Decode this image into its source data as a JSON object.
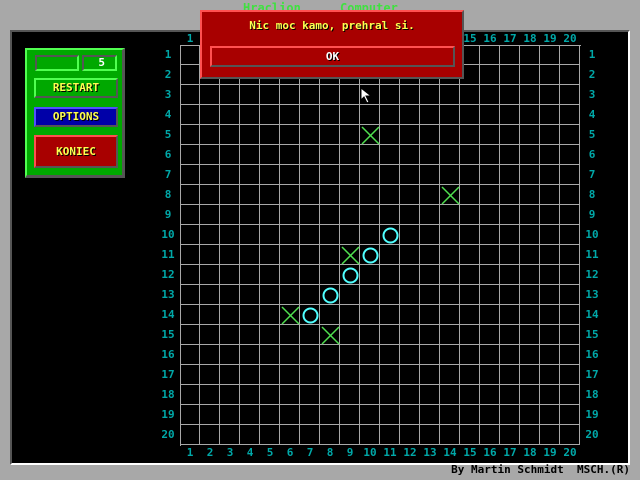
{
  "header": {
    "player_label": "Hraclion",
    "computer_label": "Computer"
  },
  "side_panel": {
    "name_value": "",
    "score_value": "5",
    "restart_label": "RESTART",
    "options_label": "OPTIONS",
    "quit_label": "KONIEC"
  },
  "board": {
    "columns": [
      "1",
      "2",
      "3",
      "4",
      "5",
      "6",
      "7",
      "8",
      "9",
      "10",
      "11",
      "12",
      "13",
      "14",
      "15",
      "16",
      "17",
      "18",
      "19",
      "20"
    ],
    "rows": [
      "1",
      "2",
      "3",
      "4",
      "5",
      "6",
      "7",
      "8",
      "9",
      "10",
      "11",
      "12",
      "13",
      "14",
      "15",
      "16",
      "17",
      "18",
      "19",
      "20"
    ],
    "x_marks": [
      [
        10,
        5
      ],
      [
        14,
        8
      ],
      [
        9,
        11
      ],
      [
        6,
        14
      ],
      [
        8,
        15
      ]
    ],
    "o_marks": [
      [
        11,
        10
      ],
      [
        10,
        11
      ],
      [
        9,
        12
      ],
      [
        8,
        13
      ],
      [
        7,
        14
      ]
    ],
    "x_color": "#50e050",
    "o_color": "#50ffff"
  },
  "dialog": {
    "message": "Nic moc kamo, prehral si.",
    "ok_label": "OK"
  },
  "footer": {
    "author": "By Martin Schmidt",
    "brand": "MSCH.(R)"
  }
}
